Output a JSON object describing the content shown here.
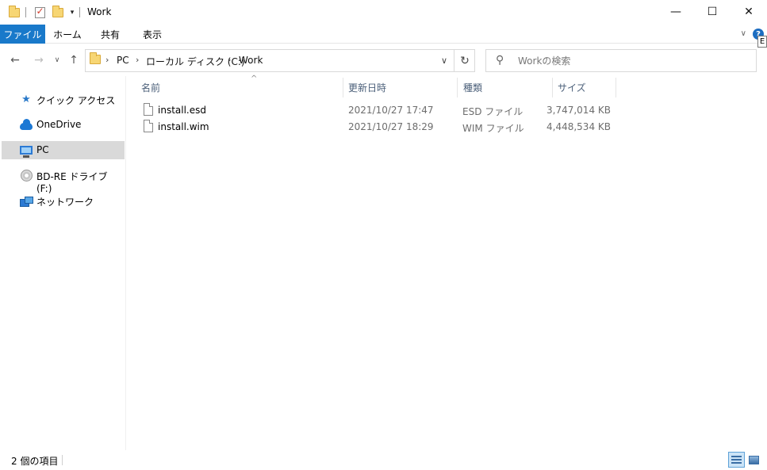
{
  "window": {
    "title": "Work",
    "minimize_glyph": "—",
    "maximize_glyph": "☐",
    "close_glyph": "✕"
  },
  "quick_access": {
    "dropdown_glyph": "▾"
  },
  "ribbon": {
    "tabs": [
      "ファイル",
      "ホーム",
      "共有",
      "表示"
    ],
    "collapse_glyph": "∨",
    "help_glyph": "?",
    "tooltip_glyph": "E"
  },
  "navigation": {
    "back_glyph": "←",
    "forward_glyph": "→",
    "recent_glyph": "∨",
    "up_glyph": "↑"
  },
  "address": {
    "path": [
      "PC",
      "ローカル ディスク (C:)",
      "Work"
    ],
    "chevron": "›",
    "dropdown_glyph": "∨",
    "refresh_glyph": "↻"
  },
  "search": {
    "placeholder": "Workの検索",
    "icon_glyph": "⚲"
  },
  "sidebar": {
    "items": [
      {
        "label": "クイック アクセス",
        "icon": "star-icon",
        "glyph": "★",
        "selected": false
      },
      {
        "label": "OneDrive",
        "icon": "cloud-icon",
        "selected": false
      },
      {
        "label": "PC",
        "icon": "pc-icon",
        "selected": true
      },
      {
        "label": "BD-RE ドライブ (F:)",
        "icon": "disc-icon",
        "selected": false
      },
      {
        "label": "ネットワーク",
        "icon": "network-icon",
        "selected": false
      }
    ]
  },
  "file_list": {
    "sort_glyph": "^",
    "columns": [
      "名前",
      "更新日時",
      "種類",
      "サイズ"
    ],
    "rows": [
      {
        "name": "install.esd",
        "modified": "2021/10/27 17:47",
        "type": "ESD ファイル",
        "size": "3,747,014 KB"
      },
      {
        "name": "install.wim",
        "modified": "2021/10/27 18:29",
        "type": "WIM ファイル",
        "size": "4,448,534 KB"
      }
    ]
  },
  "status_bar": {
    "item_count": "2 個の項目"
  },
  "colors": {
    "file_tab": "#1979ca",
    "selected_nav": "#d9d9d9",
    "header_text": "#4c607a",
    "meta_text": "#6d6d6d"
  }
}
